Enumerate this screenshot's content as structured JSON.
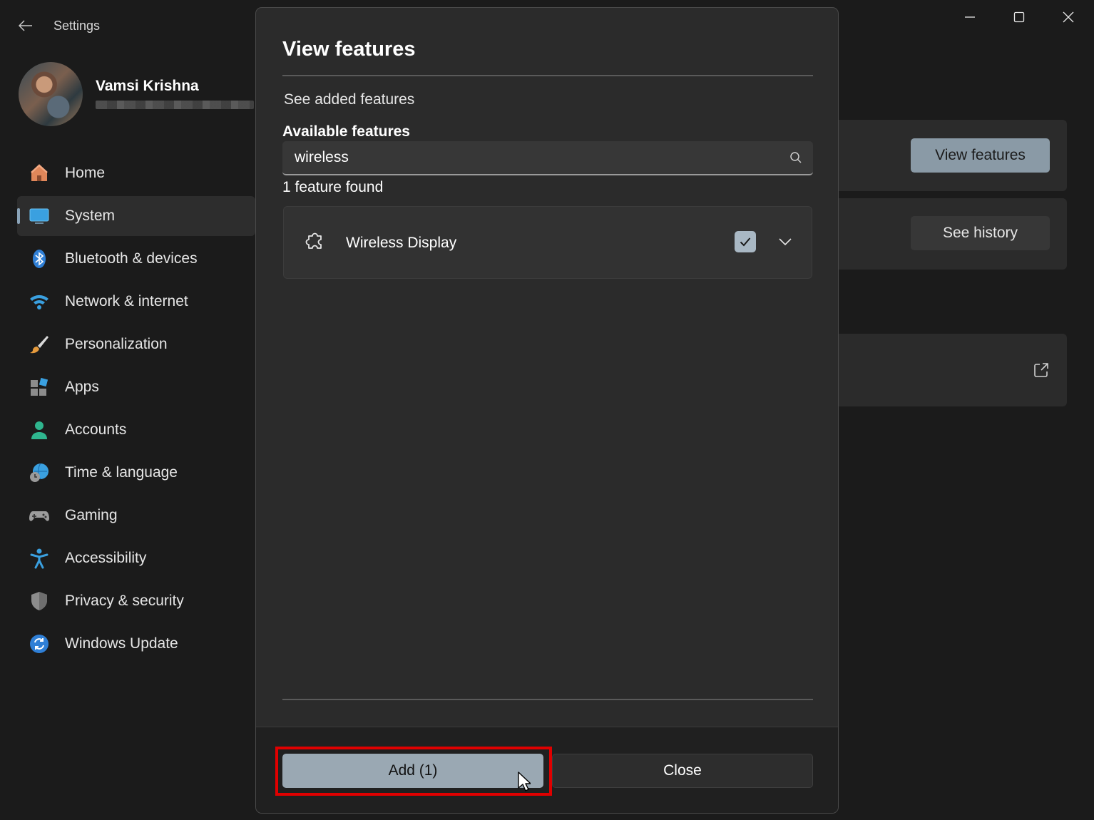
{
  "window": {
    "title": "Settings",
    "back_icon": "back-arrow-icon",
    "controls": [
      "minimize-icon",
      "maximize-icon",
      "close-icon"
    ]
  },
  "profile": {
    "name": "Vamsi Krishna"
  },
  "sidebar": {
    "items": [
      {
        "label": "Home",
        "icon": "home-icon",
        "selected": false
      },
      {
        "label": "System",
        "icon": "system-icon",
        "selected": true
      },
      {
        "label": "Bluetooth & devices",
        "icon": "bluetooth-icon",
        "selected": false
      },
      {
        "label": "Network & internet",
        "icon": "wifi-icon",
        "selected": false
      },
      {
        "label": "Personalization",
        "icon": "brush-icon",
        "selected": false
      },
      {
        "label": "Apps",
        "icon": "apps-icon",
        "selected": false
      },
      {
        "label": "Accounts",
        "icon": "person-icon",
        "selected": false
      },
      {
        "label": "Time & language",
        "icon": "globe-clock-icon",
        "selected": false
      },
      {
        "label": "Gaming",
        "icon": "gamepad-icon",
        "selected": false
      },
      {
        "label": "Accessibility",
        "icon": "accessibility-icon",
        "selected": false
      },
      {
        "label": "Privacy & security",
        "icon": "shield-icon",
        "selected": false
      },
      {
        "label": "Windows Update",
        "icon": "update-icon",
        "selected": false
      }
    ]
  },
  "background": {
    "view_features_label": "View features",
    "see_history_label": "See history"
  },
  "dialog": {
    "title": "View features",
    "see_added": "See added features",
    "available_label": "Available features",
    "search_value": "wireless",
    "found_text": "1 feature found",
    "feature": {
      "name": "Wireless Display",
      "checked": true
    },
    "add_label": "Add (1)",
    "close_label": "Close"
  },
  "colors": {
    "accent": "#9aa8b3",
    "highlight": "#e00000",
    "background": "#1b1b1b",
    "dialog": "#2b2b2b"
  }
}
